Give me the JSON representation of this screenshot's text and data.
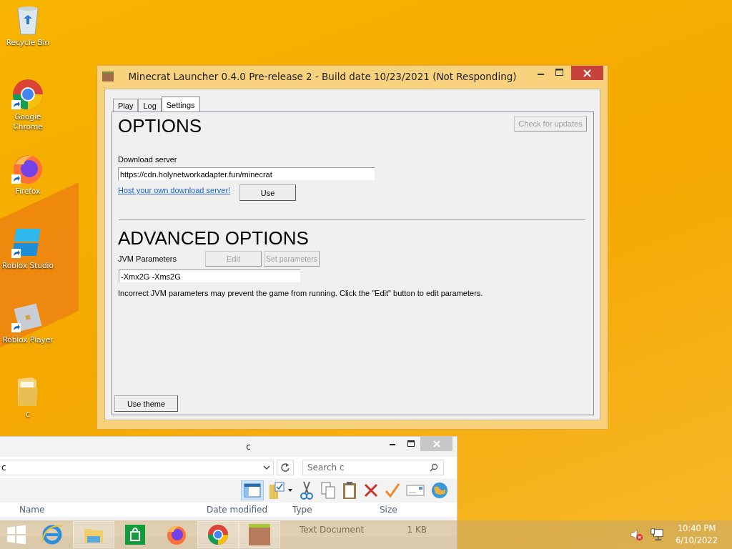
{
  "desktop_icons": [
    {
      "kind": "recycle",
      "label": "Recycle Bin",
      "shortcut": false
    },
    {
      "kind": "chrome",
      "label": "Google Chrome",
      "shortcut": true
    },
    {
      "kind": "firefox",
      "label": "Firefox",
      "shortcut": true
    },
    {
      "kind": "studio",
      "label": "Roblox Studio",
      "shortcut": true
    },
    {
      "kind": "player",
      "label": "Roblox Player",
      "shortcut": true
    },
    {
      "kind": "folder",
      "label": "c",
      "shortcut": false
    }
  ],
  "launcher": {
    "title": "Minecrat Launcher 0.4.0 Pre-release 2 - Build date 10/23/2021 (Not Responding)",
    "tabs": [
      {
        "label": "Play",
        "selected": false
      },
      {
        "label": "Log",
        "selected": false
      },
      {
        "label": "Settings",
        "selected": true
      }
    ],
    "options_heading": "OPTIONS",
    "check_updates": {
      "label": "Check for updates",
      "disabled": true
    },
    "download_server_label": "Download server",
    "download_server_value": "https://cdn.holynetworkadapter.fun/minecrat",
    "host_link": "Host your own download server!",
    "use_button": {
      "label": "Use",
      "disabled": false
    },
    "advanced_heading": "ADVANCED OPTIONS",
    "jvm_label": "JVM Parameters",
    "edit_button": {
      "label": "Edit",
      "disabled": true
    },
    "set_parameters_button": {
      "label": "Set parameters",
      "disabled": true
    },
    "jvm_value": "-Xmx2G -Xms2G",
    "warning": "Incorrect JVM parameters may prevent the game from running. Click the \"Edit\" button to edit parameters.",
    "use_theme_button": {
      "label": "Use theme",
      "disabled": false
    }
  },
  "explorer": {
    "title": "c",
    "address": "c",
    "search_placeholder": "Search c",
    "columns": [
      "Name",
      "Date modified",
      "Type",
      "Size"
    ],
    "rows": [
      {
        "type": "Text Document",
        "size": "1 KB"
      }
    ]
  },
  "taskbar": {
    "apps": [
      {
        "kind": "ie",
        "active": false
      },
      {
        "kind": "explorer",
        "active": true
      },
      {
        "kind": "store",
        "active": false
      },
      {
        "kind": "firefox",
        "active": false
      },
      {
        "kind": "chrome",
        "active": true
      },
      {
        "kind": "minecrat",
        "active": true
      }
    ],
    "time": "10:40 PM",
    "date": "6/10/2022"
  }
}
